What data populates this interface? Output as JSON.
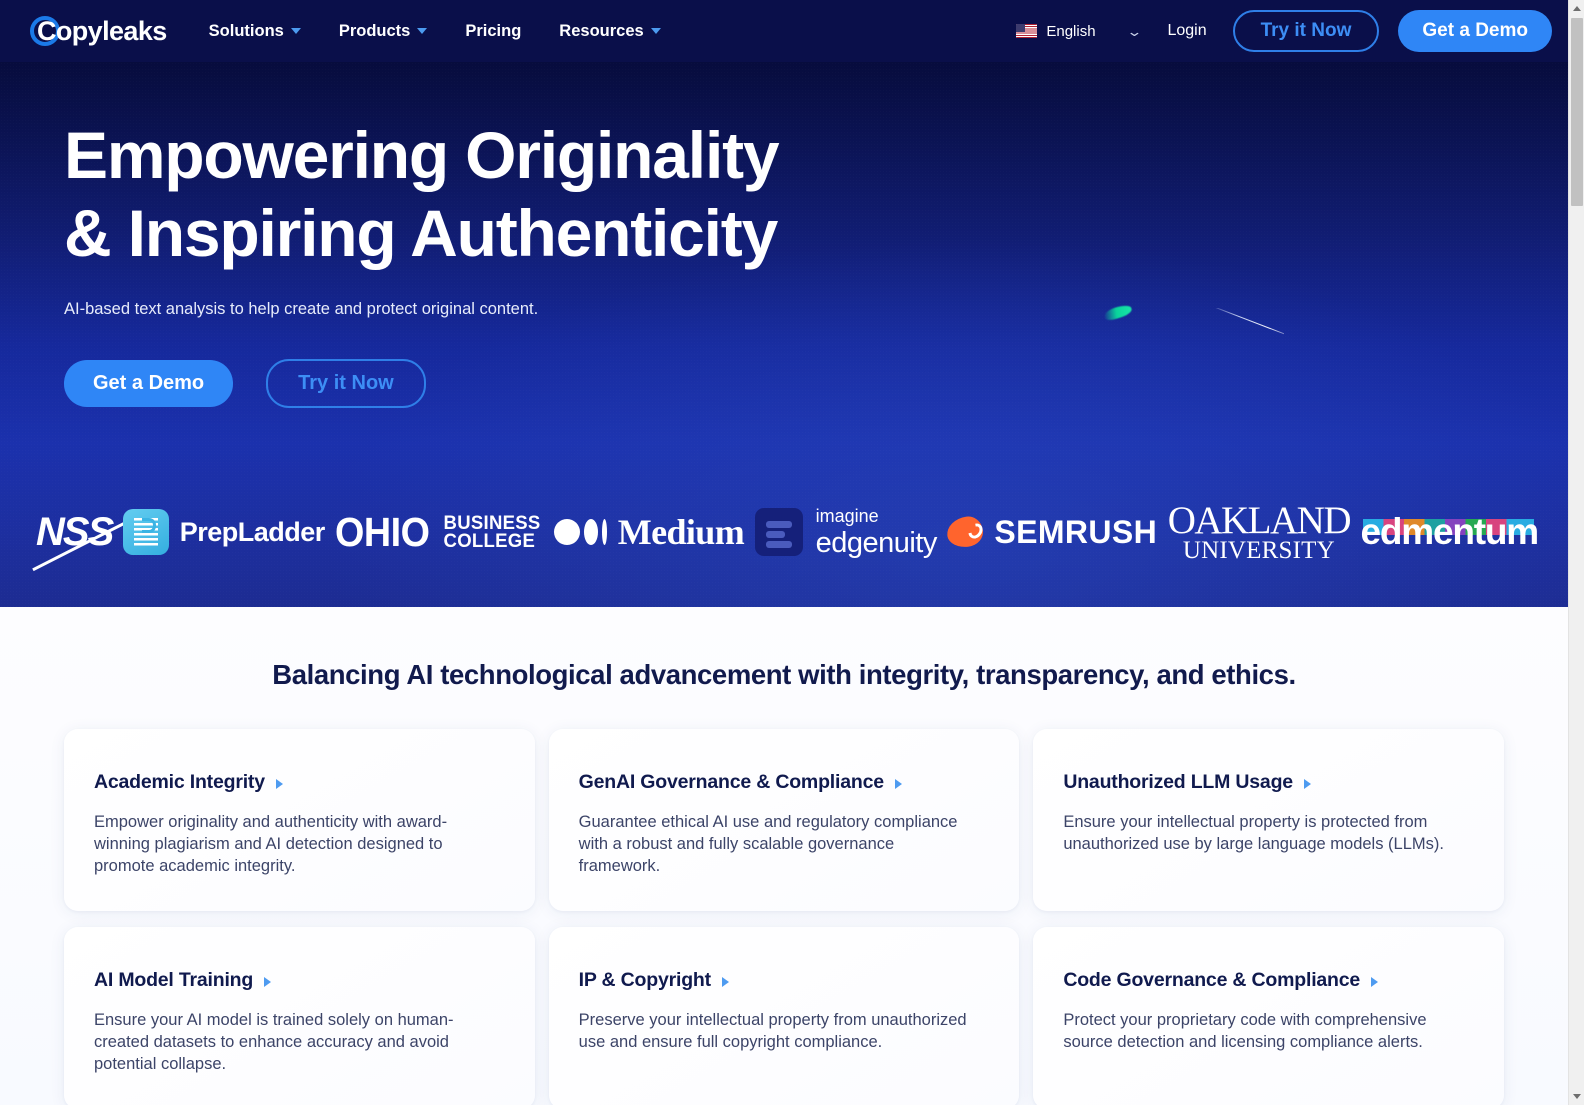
{
  "brand": {
    "name": "Copyleaks",
    "logo_icon": "copyleaks-circle-logo"
  },
  "nav": {
    "links": [
      {
        "label": "Solutions",
        "has_dropdown": true
      },
      {
        "label": "Products",
        "has_dropdown": true
      },
      {
        "label": "Pricing",
        "has_dropdown": false
      },
      {
        "label": "Resources",
        "has_dropdown": true
      }
    ],
    "language": {
      "label": "English",
      "flag_icon": "us-flag-icon",
      "chevron_icon": "chevron-down-icon"
    },
    "login_label": "Login",
    "try_label": "Try it Now",
    "demo_label": "Get a Demo"
  },
  "hero": {
    "title_line1": "Empowering Originality",
    "title_line2": "& Inspiring Authenticity",
    "subtitle": "AI-based text analysis to help create and protect original content.",
    "primary_cta": "Get a Demo",
    "secondary_cta": "Try it Now",
    "bg_top_color": "#070c3d",
    "bg_bottom_color": "#1d2c92",
    "accent_color": "#2f86f6",
    "comet_color": "#0ad49b"
  },
  "logo_strip": {
    "logos": [
      {
        "name": "NSS",
        "icon": "nss-logo"
      },
      {
        "name": "PrepLadder",
        "icon": "prepladder-logo"
      },
      {
        "name": "OHIO BUSINESS COLLEGE",
        "line1": "OHIO",
        "line2": "BUSINESS",
        "line3": "COLLEGE",
        "icon": "ohio-business-college-logo"
      },
      {
        "name": "Medium",
        "icon": "medium-logo"
      },
      {
        "name": "imagine edgenuity",
        "line1": "imagine",
        "line2": "edgenuity",
        "icon": "imagine-edgenuity-logo"
      },
      {
        "name": "SEMRUSH",
        "icon": "semrush-logo"
      },
      {
        "name": "OAKLAND UNIVERSITY",
        "line1": "OAKLAND",
        "line2": "UNIVERSITY",
        "icon": "oakland-university-logo"
      },
      {
        "name": "edmentum",
        "icon": "edmentum-logo"
      }
    ]
  },
  "section": {
    "title": "Balancing AI technological advancement with integrity, transparency, and ethics.",
    "cards": [
      {
        "title": "Academic Integrity",
        "body": "Empower originality and authenticity with award-winning plagiarism and AI detection designed to promote academic integrity."
      },
      {
        "title": "GenAI Governance & Compliance",
        "body": "Guarantee ethical AI use and regulatory compliance with a robust and fully scalable governance framework."
      },
      {
        "title": "Unauthorized LLM Usage",
        "body": "Ensure your intellectual property is protected from unauthorized use by large language models (LLMs)."
      },
      {
        "title": "AI Model Training",
        "body": "Ensure your AI model is trained solely on human-created datasets to enhance accuracy and avoid potential collapse."
      },
      {
        "title": "IP & Copyright",
        "body": "Preserve your intellectual property from unauthorized use and ensure full copyright compliance."
      },
      {
        "title": "Code Governance & Compliance",
        "body": "Protect your proprietary code with comprehensive source detection and licensing compliance alerts."
      }
    ]
  },
  "scrollbar": {
    "up_icon": "scroll-up-arrow-icon",
    "down_icon": "scroll-down-arrow-icon"
  }
}
